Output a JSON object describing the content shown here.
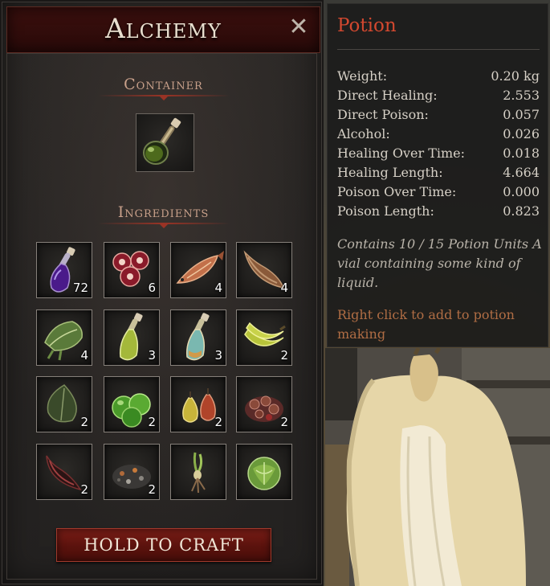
{
  "panel": {
    "title": "Alchemy",
    "close_glyph": "✕",
    "container_label": "Container",
    "ingredients_label": "Ingredients",
    "craft_label": "HOLD TO CRAFT",
    "container_item": {
      "icon": "green-potion-flask-icon"
    },
    "ingredients": [
      {
        "icon": "purple-potion-bottle-icon",
        "count": "72"
      },
      {
        "icon": "red-berries-icon",
        "count": "6"
      },
      {
        "icon": "fish-icon",
        "count": "4"
      },
      {
        "icon": "horn-icon",
        "count": "4"
      },
      {
        "icon": "herb-leaves-icon",
        "count": "4"
      },
      {
        "icon": "yellow-green-bottle-icon",
        "count": "3"
      },
      {
        "icon": "teal-bottle-icon",
        "count": "3"
      },
      {
        "icon": "bananas-icon",
        "count": "2"
      },
      {
        "icon": "dark-leaf-icon",
        "count": "2"
      },
      {
        "icon": "green-apples-icon",
        "count": "2"
      },
      {
        "icon": "pears-icon",
        "count": "2"
      },
      {
        "icon": "mushroom-pile-icon",
        "count": "2"
      },
      {
        "icon": "dark-horn-icon",
        "count": "2"
      },
      {
        "icon": "ash-pile-icon",
        "count": "2"
      },
      {
        "icon": "root-plant-icon",
        "count": ""
      },
      {
        "icon": "cabbage-icon",
        "count": ""
      }
    ]
  },
  "tooltip": {
    "title": "Potion",
    "stats": [
      {
        "label": "Weight:",
        "value": "0.20 kg"
      },
      {
        "label": "Direct Healing:",
        "value": "2.553"
      },
      {
        "label": "Direct Poison:",
        "value": "0.057"
      },
      {
        "label": "Alcohol:",
        "value": "0.026"
      },
      {
        "label": "Healing Over Time:",
        "value": "0.018"
      },
      {
        "label": "Healing Length:",
        "value": "4.664"
      },
      {
        "label": "Poison Over Time:",
        "value": "0.000"
      },
      {
        "label": "Poison Length:",
        "value": "0.823"
      }
    ],
    "description": "Contains 10 / 15 Potion Units A vial containing some kind of liquid.",
    "hint": "Right click to add to potion making"
  },
  "colors": {
    "title_red": "#d2482f",
    "hint_orange": "#b06d44",
    "button_red": "#7a1d16"
  }
}
